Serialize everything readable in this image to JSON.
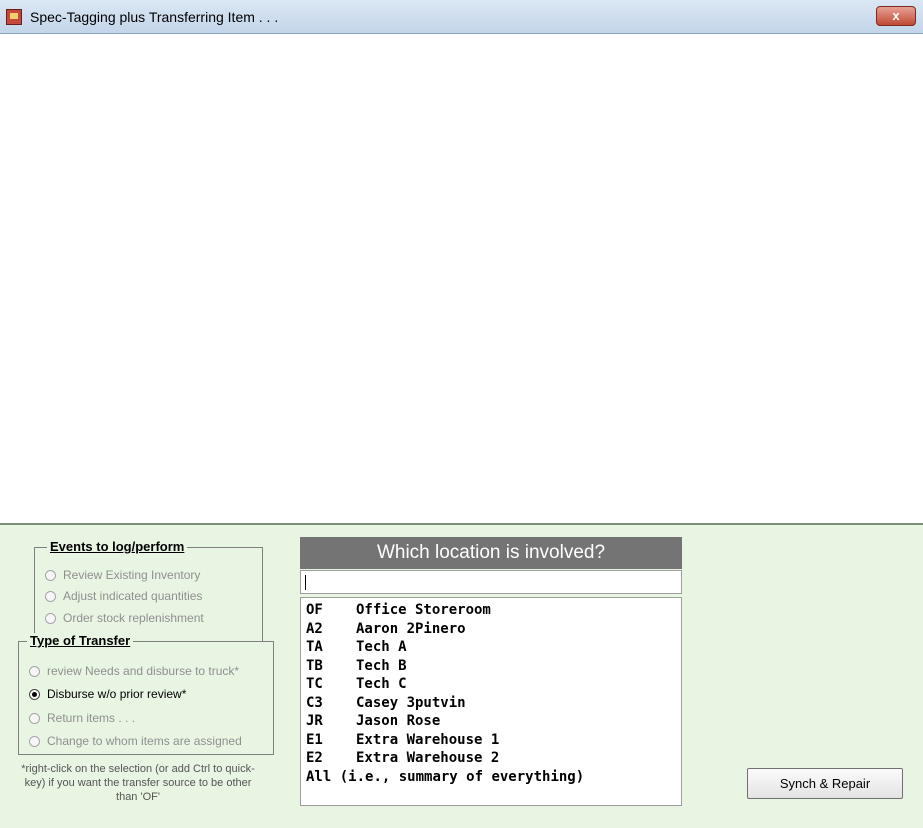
{
  "window": {
    "title": "Spec-Tagging plus Transferring Item . . .",
    "close_label": "x"
  },
  "events": {
    "legend": "Events to log/perform",
    "options": [
      {
        "label": "Review Existing Inventory",
        "checked": false,
        "enabled": false
      },
      {
        "label": "Adjust indicated quantities",
        "checked": false,
        "enabled": false
      },
      {
        "label": "Order stock replenishment",
        "checked": false,
        "enabled": false
      }
    ]
  },
  "transfer": {
    "legend": "Type of Transfer",
    "options": [
      {
        "label": "review Needs and disburse to truck*",
        "checked": false,
        "enabled": false
      },
      {
        "label": "Disburse w/o prior review*",
        "checked": true,
        "enabled": true
      },
      {
        "label": "Return items . . .",
        "checked": false,
        "enabled": false
      },
      {
        "label": "Change to whom items are assigned",
        "checked": false,
        "enabled": false
      }
    ]
  },
  "note": "*right-click on the selection (or add Ctrl to quick-key) if you want the transfer source to be other than 'OF'",
  "location": {
    "header": "Which location is involved?",
    "input_value": "",
    "items": [
      {
        "code": "OF",
        "name": "Office Storeroom"
      },
      {
        "code": "A2",
        "name": "Aaron 2Pinero"
      },
      {
        "code": "TA",
        "name": "Tech A"
      },
      {
        "code": "TB",
        "name": "Tech B"
      },
      {
        "code": "TC",
        "name": "Tech C"
      },
      {
        "code": "C3",
        "name": "Casey 3putvin"
      },
      {
        "code": "JR",
        "name": "Jason Rose"
      },
      {
        "code": "E1",
        "name": "Extra Warehouse 1"
      },
      {
        "code": "E2",
        "name": "Extra Warehouse 2"
      },
      {
        "code": "All",
        "name": "(i.e., summary of everything)"
      }
    ]
  },
  "buttons": {
    "synch_repair": "Synch & Repair"
  },
  "colors": {
    "panel_bg": "#e8f5e3",
    "header_bg": "#747474"
  }
}
